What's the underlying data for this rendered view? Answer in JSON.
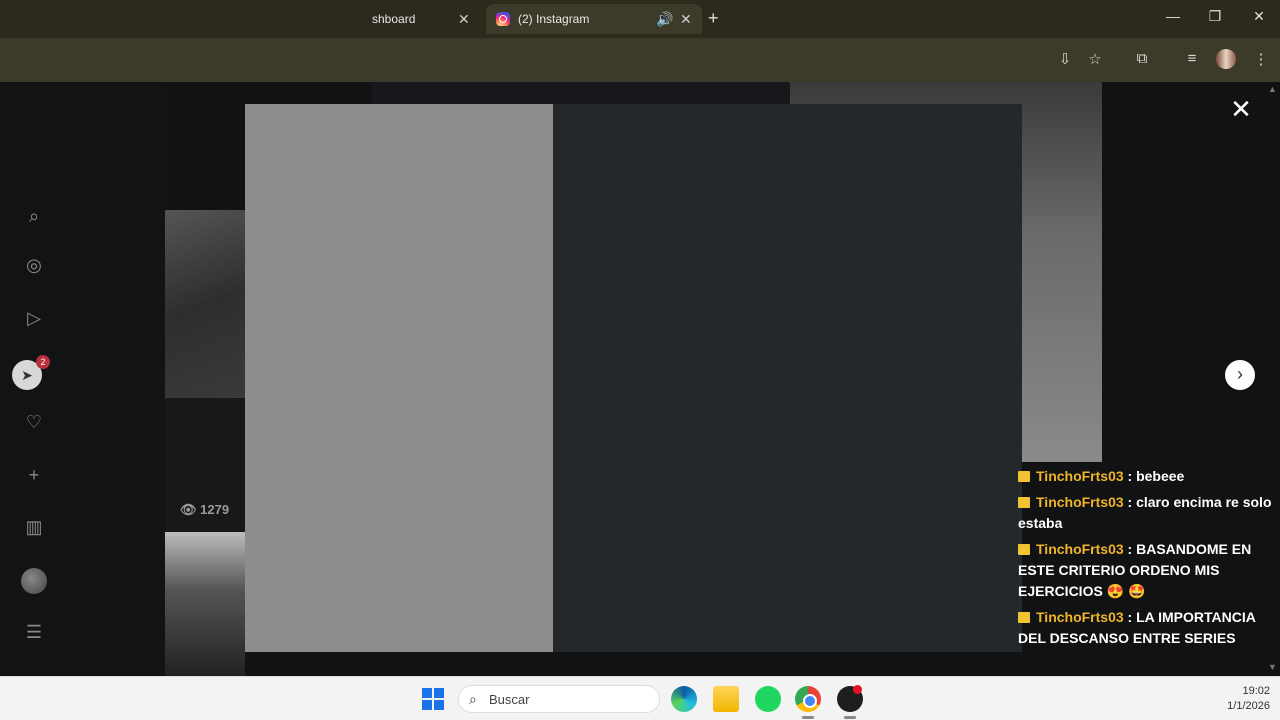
{
  "browser": {
    "tabs": [
      {
        "label": "shboard"
      },
      {
        "label": "(2) Instagram"
      }
    ]
  },
  "sidebar": {
    "message_badge_count": "2"
  },
  "feed": {
    "views_count": "1279"
  },
  "chat": {
    "messages": [
      {
        "user": "TinchoFrts03",
        "text": ": bebeee"
      },
      {
        "user": "TinchoFrts03",
        "text": ": claro encima re solo estaba"
      },
      {
        "user": "TinchoFrts03",
        "text": ": BASANDOME EN ESTE CRITERIO ORDENO MIS EJERCICIOS 😍 🤩"
      },
      {
        "user": "TinchoFrts03",
        "text": ": LA IMPORTANCIA DEL DESCANSO ENTRE SERIES"
      }
    ]
  },
  "taskbar": {
    "search_placeholder": "Buscar",
    "time": "19:02",
    "date": "1/1/2026"
  }
}
